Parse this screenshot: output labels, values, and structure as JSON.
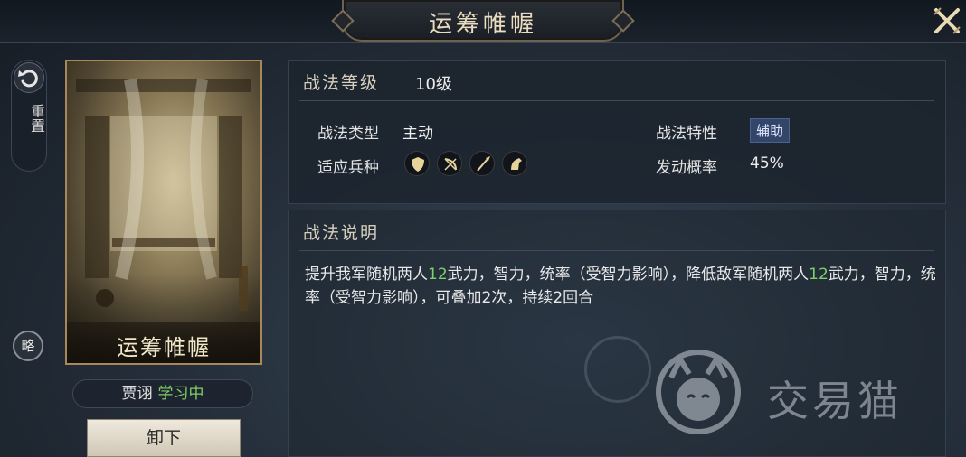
{
  "header": {
    "title": "运筹帷幄"
  },
  "side": {
    "reset_label": "重置",
    "strategy_label": "略"
  },
  "card": {
    "name": "运筹帷幄"
  },
  "learner": {
    "name": "贾诩",
    "status": "学习中"
  },
  "unequip_label": "卸下",
  "tactic_level": {
    "label": "战法等级",
    "value": "10级"
  },
  "tactic_type": {
    "label": "战法类型",
    "value": "主动"
  },
  "tactic_trait": {
    "label": "战法特性",
    "value": "辅助"
  },
  "troop_types": {
    "label": "适应兵种",
    "icons": [
      "shield-icon",
      "bow-icon",
      "spear-icon",
      "horse-icon"
    ]
  },
  "trigger_rate": {
    "label": "发动概率",
    "value": "45%"
  },
  "description": {
    "heading": "战法说明",
    "part1": "提升我军随机两人",
    "num1": "12",
    "part2": "武力，智力，统率（受智力影响），降低敌军随机两人",
    "num2": "12",
    "part3": "武力，智力，统率（受智力影响），可叠加2次，持续2回合"
  },
  "watermark": {
    "text": "交易猫"
  },
  "colors": {
    "highlight": "#7fcf6a",
    "gold": "#a8875a",
    "badge": "#33466a"
  }
}
